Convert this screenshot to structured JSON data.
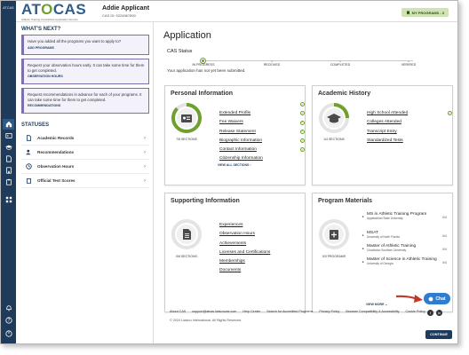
{
  "brand": {
    "logo_text_a": "AT",
    "logo_text_o": "O",
    "logo_text_b": "CAS",
    "tagline": "Athletic Training Centralized Application Service",
    "rail_logo": "ATCAS"
  },
  "applicant": {
    "name": "Addie Applicant",
    "cas_id": "CAS ID: 5224567890"
  },
  "header": {
    "my_programs": "MY PROGRAMS - 3"
  },
  "sidebar": {
    "whats_next": "WHAT'S NEXT?",
    "notices": [
      {
        "message": "Have you added all the programs you want to apply to?",
        "link": "ADD PROGRAMS"
      },
      {
        "message": "Request your observation hours early. It can take some time for them to get completed.",
        "link": "OBSERVATION HOURS"
      },
      {
        "message": "Request recommendations in advance for each of your programs. It can take some time for them to get completed.",
        "link": "RECOMMENDATIONS"
      }
    ],
    "statuses_title": "STATUSES",
    "statuses": [
      {
        "label": "Academic Records"
      },
      {
        "label": "Recommendations"
      },
      {
        "label": "Observation Hours"
      },
      {
        "label": "Official Test Scores"
      }
    ]
  },
  "main": {
    "title": "Application",
    "cas_status": "CAS Status",
    "steps": [
      "IN PROGRESS",
      "RECEIVED",
      "COMPLETED",
      "VERIFIED"
    ],
    "status_message": "Your application has not yet been submitted.",
    "personal": {
      "title": "Personal Information",
      "caption": "7/8 SECTIONS",
      "progress": 0.875,
      "items": [
        "Extended Profile",
        "Fee Waivers",
        "Release Statement",
        "Biographic Information",
        "Contact Information",
        "Citizenship Information"
      ],
      "view_all": "VIEW ALL SECTIONS"
    },
    "academic": {
      "title": "Academic History",
      "caption": "1/4 SECTIONS",
      "progress": 0.25,
      "items": [
        "High School Attended",
        "Colleges Attended",
        "Transcript Entry",
        "Standardized Tests"
      ]
    },
    "supporting": {
      "title": "Supporting Information",
      "caption": "0/6 SECTIONS",
      "progress": 0,
      "items": [
        "Experiences",
        "Observation Hours",
        "Achievements",
        "Licenses and Certifications",
        "Memberships",
        "Documents"
      ]
    },
    "program_materials": {
      "title": "Program Materials",
      "caption": "0/3 PROGRAMS",
      "progress": 0,
      "items": [
        {
          "title": "MS in Athletic Training Program",
          "school": "Appalachian State University"
        },
        {
          "title": "MSAT",
          "school": "University of North Florida"
        },
        {
          "title": "Master of Athletic Training",
          "school": "Charleston Southern University"
        },
        {
          "title": "Master of Science in Athletic Training",
          "school": "University of Georgia"
        }
      ],
      "badge": "0/4",
      "view_more": "VIEW MORE"
    }
  },
  "footer": {
    "links": [
      "About CAS",
      "support@atcas.liaisoncas.com",
      "Help Center",
      "Search for Accredited Programs",
      "Privacy Policy",
      "Browser Compatibility & Accessibility",
      "Cookie Policy"
    ],
    "copyright": "© 2024 Liaison International. All Rights Reserved."
  },
  "buttons": {
    "continue": "CONTINUE",
    "chat": "Chat"
  },
  "colors": {
    "navy": "#1f3b5c",
    "green": "#6f9f2f",
    "purple": "#7d6fb0",
    "chat_blue": "#2d7dd2",
    "arrow_red": "#c0392b"
  }
}
